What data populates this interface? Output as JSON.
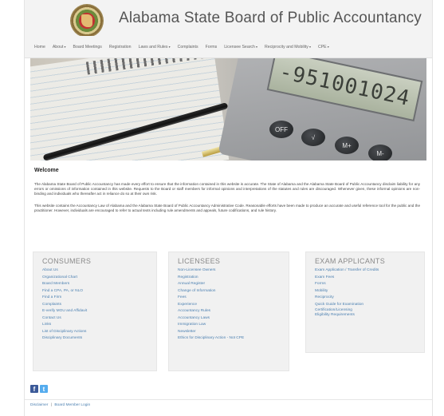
{
  "header": {
    "title": "Alabama State Board of Public Accountancy"
  },
  "nav": {
    "items": [
      {
        "label": "Home"
      },
      {
        "label": "About"
      },
      {
        "label": "Board Meetings"
      },
      {
        "label": "Registration"
      },
      {
        "label": "Laws and Rules"
      },
      {
        "label": "Complaints"
      },
      {
        "label": "Forms"
      },
      {
        "label": "Licensee Search"
      },
      {
        "label": "Reciprocity and Mobility"
      },
      {
        "label": "CPE"
      }
    ]
  },
  "hero": {
    "calculator_display": "-951001024",
    "keys": [
      "OFF",
      "√",
      "M+",
      "M-"
    ]
  },
  "welcome": {
    "title": "Welcome",
    "p1": "The Alabama State Board of Public Accountancy has made every effort to ensure that the information contained in this website is accurate. The State of Alabama and the Alabama State Board of Public Accountancy disclaim liability for any errors or omissions of information contained in this website. Requests to the Board or staff members for informal opinions and interpretations of the statutes and rules are discouraged. Whenever given, these informal opinions are non-binding and individuals who thereafter act in reliance do so at their own risk.",
    "p2": "This website contains the Accountancy Law of Alabama and the Alabama State Board of Public Accountancy Administrative Code. Reasonable efforts have been made to produce an accurate and useful reference tool for the public and the practitioner. However, individuals are encouraged to refer to actual texts including rule amendments and appeals, future codifications, and rule history."
  },
  "consumers": {
    "heading": "CONSUMERS",
    "links": [
      "About Us",
      "Organizational Chart",
      "Board Members",
      "Find a CPA, PA, or NLO",
      "Find a Firm",
      "Complaints",
      "E-verify MOU and Affidavit",
      "Contact Us",
      "Links",
      "List of Disciplinary Actions",
      "Disciplinary Documents"
    ]
  },
  "licensees": {
    "heading": "LICENSEES",
    "links": [
      "Non-Licensee Owners",
      "Registration",
      "Annual Register",
      "Change of Information",
      "Fees",
      "Experience",
      "Accountancy Rules",
      "Accountancy Laws",
      "Immigration Law",
      "Newsletter",
      "Ethics for Disciplinary Action - Not CPE"
    ]
  },
  "exam_applicants": {
    "heading": "EXAM APPLICANTS",
    "links": [
      "Exam Application / Transfer of Credits",
      "Exam Fees",
      "Forms",
      "Mobility",
      "Reciprocity",
      "Quick Guide for Examination",
      "Certification/Licensing",
      "Eligibility Requirements"
    ]
  },
  "social": {
    "facebook": "f",
    "twitter": "t"
  },
  "footer": {
    "disclaimer": "Disclaimer",
    "separator": "|",
    "login": "Board Member Login"
  }
}
